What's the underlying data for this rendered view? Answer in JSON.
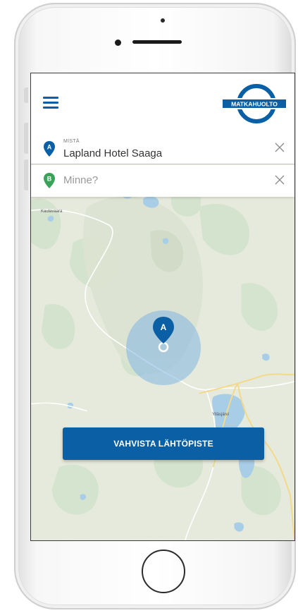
{
  "app": {
    "logo_text": "MATKAHUOLTO",
    "brand_color": "#0b5fa5",
    "menu_icon": "hamburger-menu-icon"
  },
  "origin": {
    "marker": "A",
    "label": "MISTÄ",
    "value": "Lapland Hotel Saaga",
    "clear_icon": "close-icon"
  },
  "destination": {
    "marker": "B",
    "placeholder": "Minne?",
    "clear_icon": "close-icon"
  },
  "map": {
    "place_labels": [
      "Kaulavaara",
      "Ylläsjärvi"
    ],
    "location_marker": "A"
  },
  "confirm_button": {
    "label": "VAHVISTA LÄHTÖPISTE"
  }
}
